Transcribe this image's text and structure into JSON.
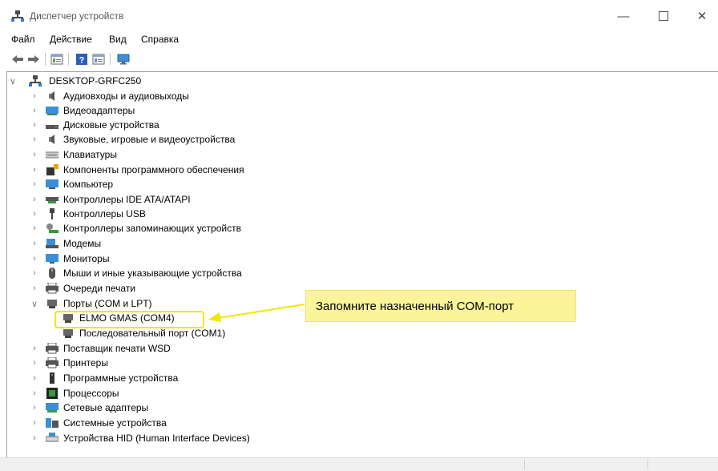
{
  "window": {
    "title": "Диспетчер устройств"
  },
  "menu": [
    "Файл",
    "Действие",
    "Вид",
    "Справка"
  ],
  "tree": {
    "root": "DESKTOP-GRFC250",
    "items": [
      {
        "label": "Аудиовходы и аудиовыходы",
        "icon": "audio-icon"
      },
      {
        "label": "Видеоадаптеры",
        "icon": "display-adapter-icon"
      },
      {
        "label": "Дисковые устройства",
        "icon": "disk-drive-icon"
      },
      {
        "label": "Звуковые, игровые и видеоустройства",
        "icon": "sound-icon"
      },
      {
        "label": "Клавиатуры",
        "icon": "keyboard-icon"
      },
      {
        "label": "Компоненты программного обеспечения",
        "icon": "software-component-icon"
      },
      {
        "label": "Компьютер",
        "icon": "computer-icon"
      },
      {
        "label": "Контроллеры IDE ATA/ATAPI",
        "icon": "ide-controller-icon"
      },
      {
        "label": "Контроллеры USB",
        "icon": "usb-icon"
      },
      {
        "label": "Контроллеры запоминающих устройств",
        "icon": "storage-controller-icon"
      },
      {
        "label": "Модемы",
        "icon": "modem-icon"
      },
      {
        "label": "Мониторы",
        "icon": "monitor-icon"
      },
      {
        "label": "Мыши и иные указывающие устройства",
        "icon": "mouse-icon"
      },
      {
        "label": "Очереди печати",
        "icon": "print-queue-icon"
      },
      {
        "label": "Порты (COM и LPT)",
        "icon": "port-icon"
      },
      {
        "label": "ELMO GMAS (COM4)",
        "icon": "port-icon"
      },
      {
        "label": "Последовательный порт (COM1)",
        "icon": "port-icon"
      },
      {
        "label": "Поставщик печати WSD",
        "icon": "printer-icon"
      },
      {
        "label": "Принтеры",
        "icon": "printer-icon"
      },
      {
        "label": "Программные устройства",
        "icon": "software-device-icon"
      },
      {
        "label": "Процессоры",
        "icon": "processor-icon"
      },
      {
        "label": "Сетевые адаптеры",
        "icon": "network-adapter-icon"
      },
      {
        "label": "Системные устройства",
        "icon": "system-device-icon"
      },
      {
        "label": "Устройства HID (Human Interface Devices)",
        "icon": "hid-icon"
      }
    ]
  },
  "callout": "Запомните назначенный COM-порт",
  "colors": {
    "highlight": "#f2e600",
    "callout_bg": "#fbf59a"
  }
}
